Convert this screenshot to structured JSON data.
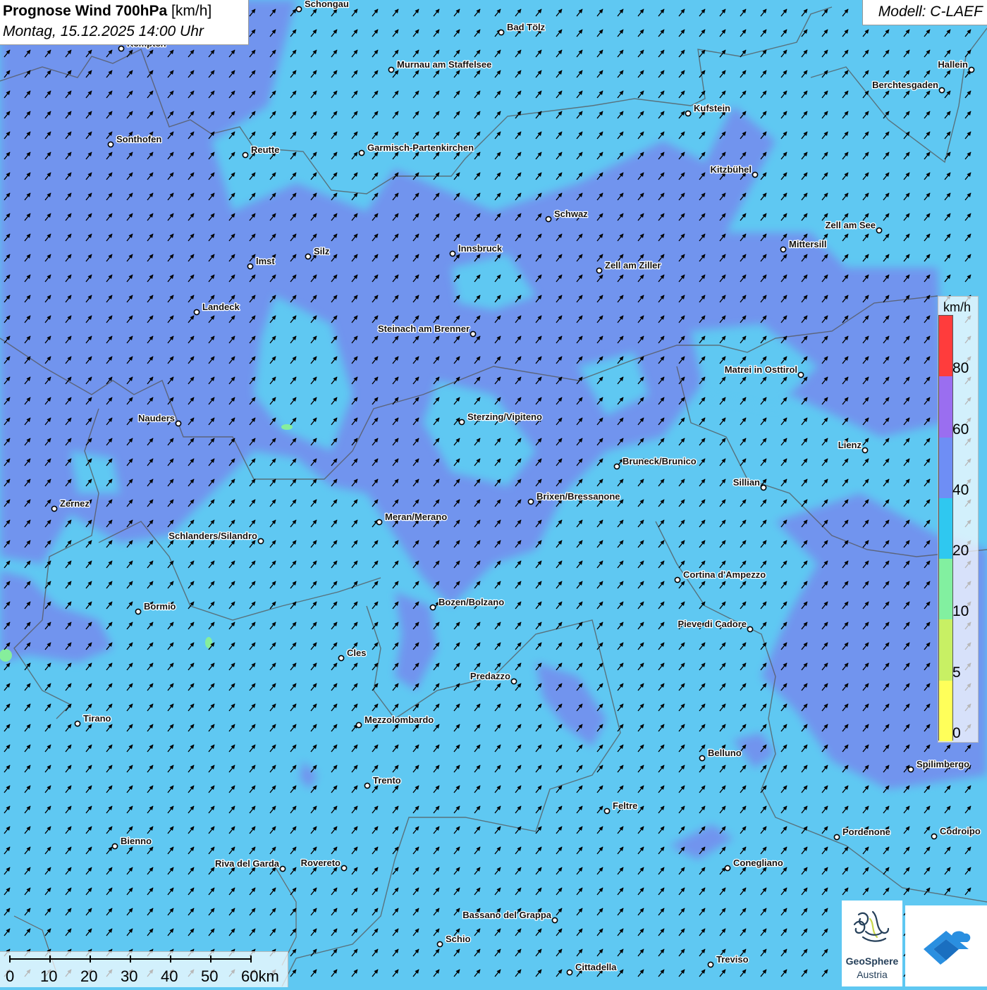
{
  "title": {
    "main": "Prognose Wind 700hPa",
    "unit": "[km/h]",
    "datetime": "Montag, 15.12.2025 14:00 Uhr"
  },
  "model": "Modell: C-LAEF",
  "legend": {
    "unit": "km/h",
    "classes": [
      {
        "from": 0,
        "to": 5,
        "color": "#ffff5a"
      },
      {
        "from": 5,
        "to": 10,
        "color": "#c8f064"
      },
      {
        "from": 10,
        "to": 20,
        "color": "#82f0a0"
      },
      {
        "from": 20,
        "to": 40,
        "color": "#2fc8f0"
      },
      {
        "from": 40,
        "to": 60,
        "color": "#6e8ef5"
      },
      {
        "from": 60,
        "to": 80,
        "color": "#9a6ef0"
      },
      {
        "from": 80,
        "to": 100,
        "color": "#ff3c3c"
      }
    ],
    "labels": [
      "0",
      "5",
      "10",
      "20",
      "40",
      "60",
      "80"
    ]
  },
  "scale": {
    "labels": [
      "0",
      "10",
      "20",
      "30",
      "40",
      "50",
      "60km"
    ]
  },
  "wind": {
    "direction": "SW",
    "arrow_color": "#000000"
  },
  "cities": [
    "Schongau",
    "Bad Tölz",
    "Kempten",
    "Murnau am Staffelsee",
    "Hallein",
    "Berchtesgaden",
    "Kufstein",
    "Sonthofen",
    "Reutte",
    "Garmisch-Partenkirchen",
    "Kitzbühel",
    "Schwaz",
    "Zell am See",
    "Mittersill",
    "Innsbruck",
    "Imst",
    "Silz",
    "Zell am Ziller",
    "Landeck",
    "Steinach am Brenner",
    "Matrei in Osttirol",
    "Nauders",
    "Sterzing/Vipiteno",
    "Lienz",
    "Bruneck/Brunico",
    "Sillian",
    "Zernez",
    "Brixen/Bressanone",
    "Meran/Merano",
    "Schlanders/Silandro",
    "Cortina d'Ampezzo",
    "Bormio",
    "Bozen/Bolzano",
    "Pieve di Cadore",
    "Cles",
    "Predazzo",
    "Tirano",
    "Mezzolombardo",
    "Belluno",
    "Spilimbergo",
    "Trento",
    "Feltre",
    "Pordenone",
    "Codroipo",
    "Bienno",
    "Riva del Garda",
    "Rovereto",
    "Conegliano",
    "Bassano del Grappa",
    "Schio",
    "Treviso",
    "Cittadella"
  ],
  "logos": {
    "geosphere_name": "GeoSphere",
    "geosphere_sub": "Austria"
  }
}
